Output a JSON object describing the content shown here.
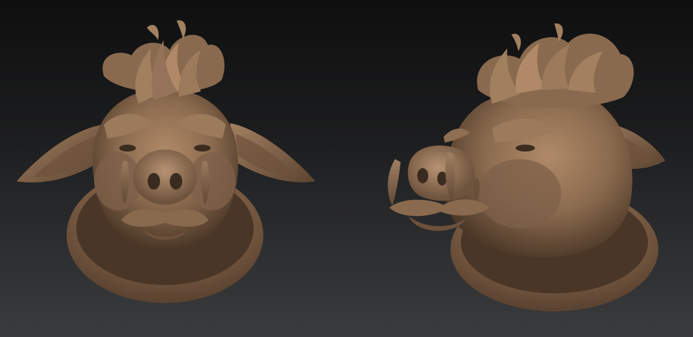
{
  "scene": {
    "views": [
      {
        "id": "front",
        "subject": "boar-head-sculpt"
      },
      {
        "id": "three-quarter",
        "subject": "boar-head-sculpt"
      }
    ],
    "colors": {
      "background_top": "#0f0f10",
      "background_bottom": "#3a3b3d",
      "clay_light": "#b08a68",
      "clay_mid": "#8a6a4e",
      "clay_dark": "#4c3828",
      "clay_shadow": "#2e2218"
    }
  }
}
